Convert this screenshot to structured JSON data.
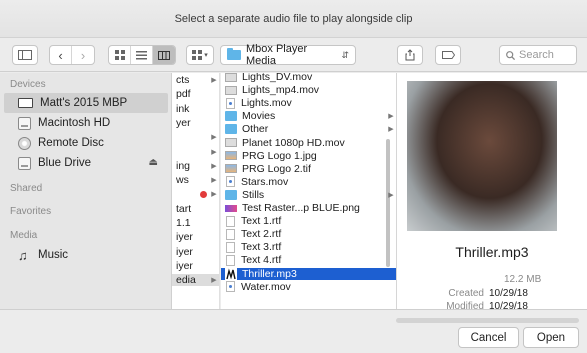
{
  "window": {
    "title": "Select a separate audio file to play alongside clip"
  },
  "toolbar": {
    "location": "Mbox Player Media",
    "search_placeholder": "Search"
  },
  "sidebar": {
    "devices_header": "Devices",
    "devices": [
      {
        "label": "Matt's 2015 MBP",
        "icon": "laptop-icon",
        "selected": true
      },
      {
        "label": "Macintosh HD",
        "icon": "hard-drive-icon"
      },
      {
        "label": "Remote Disc",
        "icon": "disc-icon"
      },
      {
        "label": "Blue Drive",
        "icon": "hard-drive-icon",
        "ejectable": true
      }
    ],
    "shared_header": "Shared",
    "favorites_header": "Favorites",
    "media_header": "Media",
    "media": [
      {
        "label": "Music",
        "icon": "music-note-icon"
      }
    ]
  },
  "column1": {
    "rows": [
      {
        "label": "cts",
        "folder": true
      },
      {
        "label": "pdf",
        "folder": false
      },
      {
        "label": "ink",
        "folder": false
      },
      {
        "label": "yer",
        "folder": false
      },
      {
        "label": "",
        "folder": true
      },
      {
        "label": "",
        "folder": true
      },
      {
        "label": "ing",
        "folder": true
      },
      {
        "label": "ws",
        "folder": true
      },
      {
        "label": "",
        "folder": true,
        "tag": "#e23b3b"
      },
      {
        "label": "tart",
        "folder": false
      },
      {
        "label": "1.1",
        "folder": false
      },
      {
        "label": "iyer",
        "folder": false
      },
      {
        "label": "iyer",
        "folder": false
      },
      {
        "label": "iyer",
        "folder": false
      },
      {
        "label": "edia",
        "folder": true,
        "highlight": true
      }
    ]
  },
  "column2": {
    "rows": [
      {
        "label": "Lights_DV.mov",
        "kind": "img2"
      },
      {
        "label": "Lights_mp4.mov",
        "kind": "img2"
      },
      {
        "label": "Lights.mov",
        "kind": "mov"
      },
      {
        "label": "Movies",
        "kind": "folder",
        "arrow": true
      },
      {
        "label": "Other",
        "kind": "folder",
        "arrow": true
      },
      {
        "label": "Planet 1080p HD.mov",
        "kind": "img2"
      },
      {
        "label": "PRG Logo 1.jpg",
        "kind": "img"
      },
      {
        "label": "PRG Logo 2.tif",
        "kind": "img"
      },
      {
        "label": "Stars.mov",
        "kind": "mov"
      },
      {
        "label": "Stills",
        "kind": "folder",
        "arrow": true
      },
      {
        "label": "Test Raster...p BLUE.png",
        "kind": "png"
      },
      {
        "label": "Text 1.rtf",
        "kind": "file"
      },
      {
        "label": "Text 2.rtf",
        "kind": "file"
      },
      {
        "label": "Text 3.rtf",
        "kind": "file"
      },
      {
        "label": "Text 4.rtf",
        "kind": "file"
      },
      {
        "label": "Thriller.mp3",
        "kind": "mp3",
        "selected": true
      },
      {
        "label": "Water.mov",
        "kind": "mov"
      }
    ]
  },
  "preview": {
    "name": "Thriller.mp3",
    "size": "12.2 MB",
    "created_label": "Created",
    "created_value": "10/29/18",
    "modified_label": "Modified",
    "modified_value": "10/29/18"
  },
  "footer": {
    "cancel_label": "Cancel",
    "open_label": "Open"
  }
}
